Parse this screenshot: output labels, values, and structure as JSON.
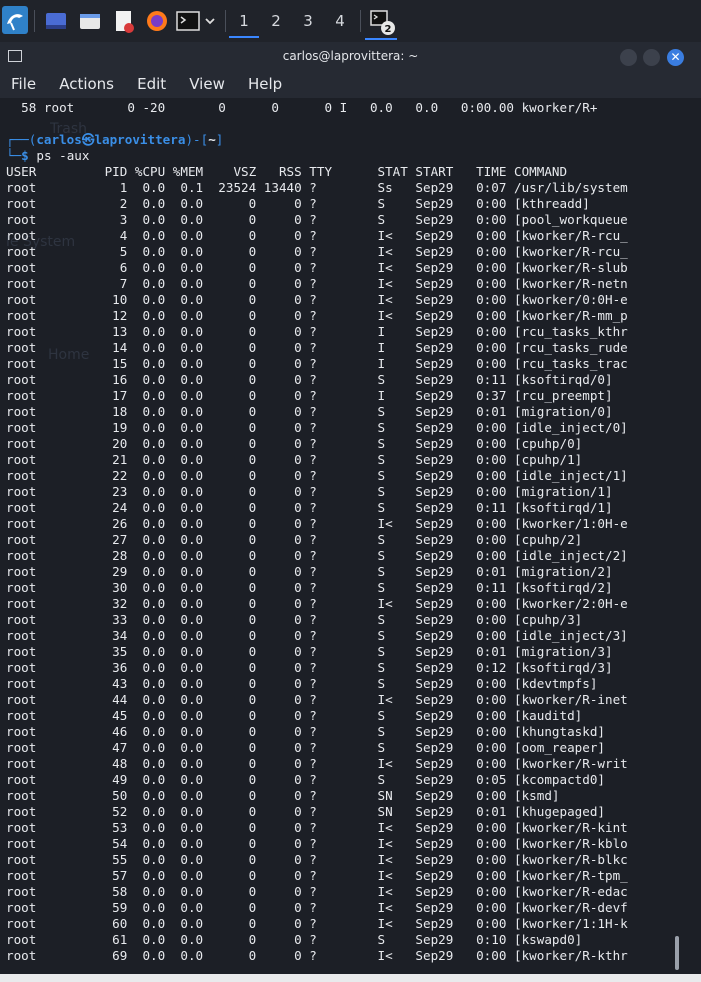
{
  "taskbar": {
    "desktops": [
      "1",
      "2",
      "3",
      "4"
    ],
    "terminal_badge": "2"
  },
  "window": {
    "title": "carlos@laprovittera: ~"
  },
  "menu": [
    "File",
    "Actions",
    "Edit",
    "View",
    "Help"
  ],
  "desktop_labels": {
    "trash": "Trash",
    "filesystem": "le System",
    "home": "Home"
  },
  "terminal": {
    "previous_line": "  58 root       0 -20       0      0      0 I   0.0   0.0   0:00.00 kworker/R+",
    "prompt": {
      "open": "┌──(",
      "user": "carlos",
      "at": "㉿",
      "host": "laprovittera",
      "close": ")-[",
      "cwd": "~",
      "end": "]",
      "line2": "└─",
      "sign": "$",
      "command": "ps -aux"
    },
    "header": "USER         PID %CPU %MEM    VSZ   RSS TTY      STAT START   TIME COMMAND",
    "rows": [
      "root           1  0.0  0.1  23524 13440 ?        Ss   Sep29   0:07 /usr/lib/system",
      "root           2  0.0  0.0      0     0 ?        S    Sep29   0:00 [kthreadd]",
      "root           3  0.0  0.0      0     0 ?        S    Sep29   0:00 [pool_workqueue",
      "root           4  0.0  0.0      0     0 ?        I<   Sep29   0:00 [kworker/R-rcu_",
      "root           5  0.0  0.0      0     0 ?        I<   Sep29   0:00 [kworker/R-rcu_",
      "root           6  0.0  0.0      0     0 ?        I<   Sep29   0:00 [kworker/R-slub",
      "root           7  0.0  0.0      0     0 ?        I<   Sep29   0:00 [kworker/R-netn",
      "root          10  0.0  0.0      0     0 ?        I<   Sep29   0:00 [kworker/0:0H-e",
      "root          12  0.0  0.0      0     0 ?        I<   Sep29   0:00 [kworker/R-mm_p",
      "root          13  0.0  0.0      0     0 ?        I    Sep29   0:00 [rcu_tasks_kthr",
      "root          14  0.0  0.0      0     0 ?        I    Sep29   0:00 [rcu_tasks_rude",
      "root          15  0.0  0.0      0     0 ?        I    Sep29   0:00 [rcu_tasks_trac",
      "root          16  0.0  0.0      0     0 ?        S    Sep29   0:11 [ksoftirqd/0]",
      "root          17  0.0  0.0      0     0 ?        I    Sep29   0:37 [rcu_preempt]",
      "root          18  0.0  0.0      0     0 ?        S    Sep29   0:01 [migration/0]",
      "root          19  0.0  0.0      0     0 ?        S    Sep29   0:00 [idle_inject/0]",
      "root          20  0.0  0.0      0     0 ?        S    Sep29   0:00 [cpuhp/0]",
      "root          21  0.0  0.0      0     0 ?        S    Sep29   0:00 [cpuhp/1]",
      "root          22  0.0  0.0      0     0 ?        S    Sep29   0:00 [idle_inject/1]",
      "root          23  0.0  0.0      0     0 ?        S    Sep29   0:00 [migration/1]",
      "root          24  0.0  0.0      0     0 ?        S    Sep29   0:11 [ksoftirqd/1]",
      "root          26  0.0  0.0      0     0 ?        I<   Sep29   0:00 [kworker/1:0H-e",
      "root          27  0.0  0.0      0     0 ?        S    Sep29   0:00 [cpuhp/2]",
      "root          28  0.0  0.0      0     0 ?        S    Sep29   0:00 [idle_inject/2]",
      "root          29  0.0  0.0      0     0 ?        S    Sep29   0:01 [migration/2]",
      "root          30  0.0  0.0      0     0 ?        S    Sep29   0:11 [ksoftirqd/2]",
      "root          32  0.0  0.0      0     0 ?        I<   Sep29   0:00 [kworker/2:0H-e",
      "root          33  0.0  0.0      0     0 ?        S    Sep29   0:00 [cpuhp/3]",
      "root          34  0.0  0.0      0     0 ?        S    Sep29   0:00 [idle_inject/3]",
      "root          35  0.0  0.0      0     0 ?        S    Sep29   0:01 [migration/3]",
      "root          36  0.0  0.0      0     0 ?        S    Sep29   0:12 [ksoftirqd/3]",
      "root          43  0.0  0.0      0     0 ?        S    Sep29   0:00 [kdevtmpfs]",
      "root          44  0.0  0.0      0     0 ?        I<   Sep29   0:00 [kworker/R-inet",
      "root          45  0.0  0.0      0     0 ?        S    Sep29   0:00 [kauditd]",
      "root          46  0.0  0.0      0     0 ?        S    Sep29   0:00 [khungtaskd]",
      "root          47  0.0  0.0      0     0 ?        S    Sep29   0:00 [oom_reaper]",
      "root          48  0.0  0.0      0     0 ?        I<   Sep29   0:00 [kworker/R-writ",
      "root          49  0.0  0.0      0     0 ?        S    Sep29   0:05 [kcompactd0]",
      "root          50  0.0  0.0      0     0 ?        SN   Sep29   0:00 [ksmd]",
      "root          52  0.0  0.0      0     0 ?        SN   Sep29   0:01 [khugepaged]",
      "root          53  0.0  0.0      0     0 ?        I<   Sep29   0:00 [kworker/R-kint",
      "root          54  0.0  0.0      0     0 ?        I<   Sep29   0:00 [kworker/R-kblo",
      "root          55  0.0  0.0      0     0 ?        I<   Sep29   0:00 [kworker/R-blkc",
      "root          57  0.0  0.0      0     0 ?        I<   Sep29   0:00 [kworker/R-tpm_",
      "root          58  0.0  0.0      0     0 ?        I<   Sep29   0:00 [kworker/R-edac",
      "root          59  0.0  0.0      0     0 ?        I<   Sep29   0:00 [kworker/R-devf",
      "root          60  0.0  0.0      0     0 ?        I<   Sep29   0:00 [kworker/1:1H-k",
      "root          61  0.0  0.0      0     0 ?        S    Sep29   0:10 [kswapd0]",
      "root          69  0.0  0.0      0     0 ?        I<   Sep29   0:00 [kworker/R-kthr"
    ]
  },
  "colors": {
    "accent": "#3a86ff",
    "prompt": "#3a8ee6",
    "background": "#1c1f26"
  }
}
